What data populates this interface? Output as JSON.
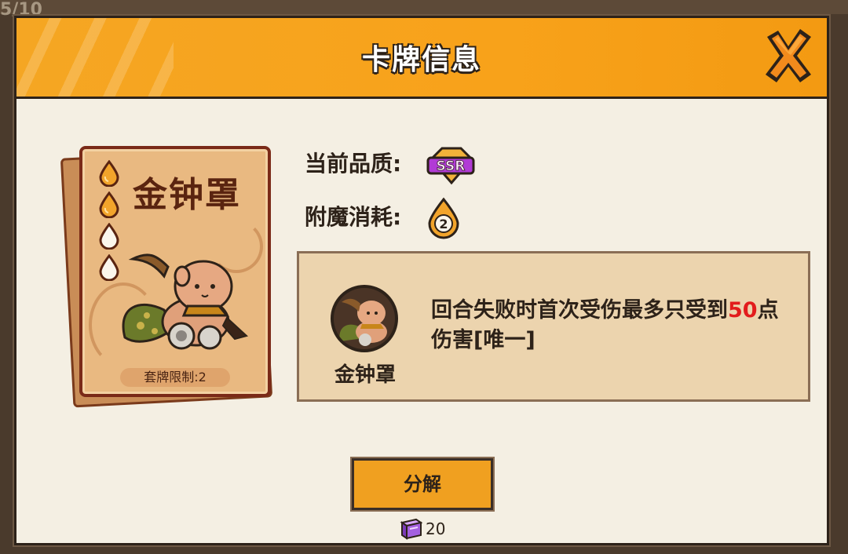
{
  "background": {
    "counter": "5/10"
  },
  "dialog": {
    "title": "卡牌信息",
    "close_icon": "close-x-icon"
  },
  "card": {
    "name": "金钟罩",
    "limit_text": "套牌限制:2",
    "cost_drops": [
      {
        "icon": "drop-icon",
        "filled": true
      },
      {
        "icon": "drop-icon",
        "filled": true
      },
      {
        "icon": "drop-icon",
        "filled": false
      },
      {
        "icon": "drop-icon",
        "filled": false
      }
    ],
    "art": "monkey-warrior-image"
  },
  "info": {
    "quality_label": "当前品质:",
    "quality_value": "SSR",
    "enchant_label": "附魔消耗:",
    "enchant_value": "2"
  },
  "description": {
    "skill_name": "金钟罩",
    "text_before": "回合失败时首次受伤最多只受到",
    "text_highlight": "50",
    "text_after": "点伤害[唯一]",
    "highlight_color": "#e21c1c"
  },
  "actions": {
    "decompose_label": "分解",
    "reward_icon": "purple-book-icon",
    "reward_count": "20"
  },
  "colors": {
    "header": "#f5a623",
    "panel": "#f4efe3",
    "desc_box": "#ecd4ae",
    "button": "#f0a020",
    "outline": "#2d2219"
  }
}
